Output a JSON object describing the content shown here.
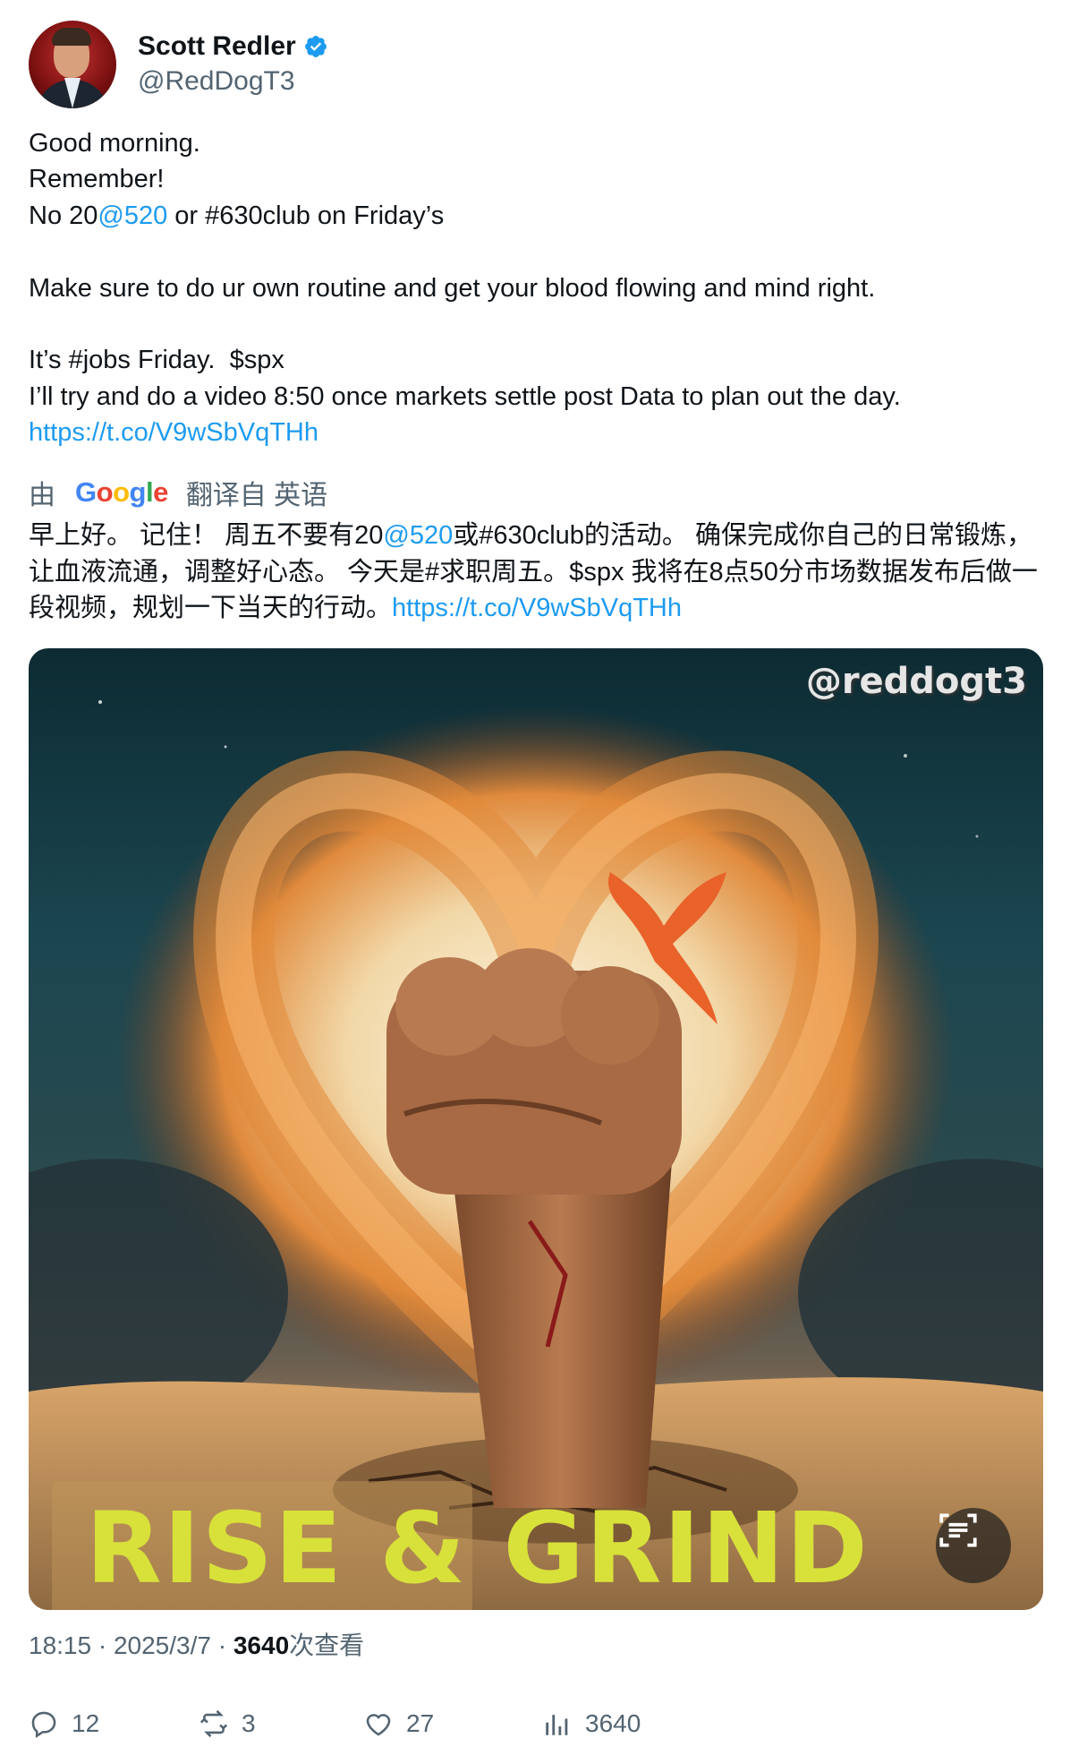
{
  "author": {
    "display_name": "Scott Redler",
    "handle": "@RedDogT3",
    "verified": true
  },
  "tweet": {
    "lines": [
      [
        "Good morning."
      ],
      [
        "Remember!"
      ],
      [
        "No 20",
        {
          "mention": "@520"
        },
        " or #630club on Friday’s"
      ],
      [
        ""
      ],
      [
        "Make sure to do ur own routine and get your blood flowing and mind right."
      ],
      [
        ""
      ],
      [
        "It’s #jobs Friday.  $spx"
      ],
      [
        "I’ll try and do a video 8:50 once markets settle post Data to plan out the day."
      ],
      [
        {
          "link": "https://t.co/V9wSbVqTHh"
        }
      ]
    ]
  },
  "translation": {
    "prefix": "由",
    "provider": "Google",
    "suffix": "翻译自 英语",
    "text_part1": "早上好。 记住！ 周五不要有20",
    "mention": "@520",
    "text_part2": "或#630club的活动。 确保完成你自己的日常锻炼，让血液流通，调整好心态。 今天是#求职周五。$spx 我将在8点50分市场数据发布后做一段视频，规划一下当天的行动。",
    "link": "https://t.co/V9wSbVqTHh"
  },
  "media": {
    "watermark": "@reddogt3",
    "title": "RISE & GRIND"
  },
  "meta": {
    "time": "18:15",
    "date": "2025/3/7",
    "views": "3640",
    "views_label": "次查看"
  },
  "actions": {
    "replies": "12",
    "reposts": "3",
    "likes": "27",
    "views": "3640"
  },
  "colors": {
    "link": "#1d9bf0",
    "verified": "#1d9bf0",
    "secondary_text": "#536471",
    "poster_title": "#d8e13a"
  },
  "icons": [
    "verified-badge-icon",
    "reply-icon",
    "repost-icon",
    "like-icon",
    "views-chart-icon",
    "text-scan-icon"
  ]
}
